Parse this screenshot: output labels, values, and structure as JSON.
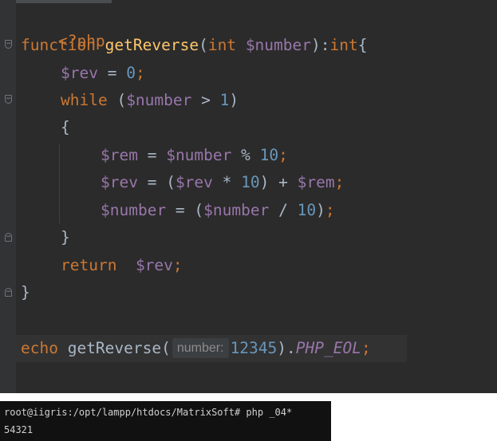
{
  "editor": {
    "lines": {
      "l1": {
        "open_tag": "<?php"
      },
      "l2": {
        "kw_function": "function",
        "fn_name": "getReverse",
        "paren_open": "(",
        "type_int": "int",
        "param": "$number",
        "paren_close": "):",
        "return_type": "int",
        "brace": "{"
      },
      "l3": {
        "var": "$rev",
        "op": " = ",
        "num": "0",
        "semi": ";"
      },
      "l4": {
        "kw_while": "while",
        "open": " (",
        "var": "$number",
        "op": " > ",
        "num": "1",
        "close": ")"
      },
      "l5": {
        "brace": "{"
      },
      "l6": {
        "var1": "$rem",
        "op1": " = ",
        "var2": "$number",
        "op2": " % ",
        "num": "10",
        "semi": ";"
      },
      "l7": {
        "var1": "$rev",
        "op1": " = (",
        "var2": "$rev",
        "op2": " * ",
        "num": "10",
        "op3": ") + ",
        "var3": "$rem",
        "semi": ";"
      },
      "l8": {
        "var1": "$number",
        "op1": " = (",
        "var2": "$number",
        "op2": " / ",
        "num": "10",
        "op3": ")",
        "semi": ";"
      },
      "l9": {
        "brace": "}"
      },
      "l10": {
        "kw_return": "return",
        "space": "  ",
        "var": "$rev",
        "semi": ";"
      },
      "l11": {
        "brace": "}"
      },
      "l12": {
        "kw_echo": "echo",
        "fn": " getReverse",
        "open": "(",
        "hint": "number:",
        "num": "12345",
        "close": ").",
        "const": "PHP_EOL",
        "semi": ";"
      }
    }
  },
  "terminal": {
    "prompt_line": "root@iigris:/opt/lampp/htdocs/MatrixSoft# php _04*",
    "output_line": "54321"
  },
  "colors": {
    "editor_bg": "#2b2b2b",
    "keyword": "#cc7832",
    "function": "#ffc66d",
    "variable": "#9876aa",
    "number": "#6897bb",
    "default_text": "#a9b7c6",
    "terminal_bg": "#111111"
  }
}
